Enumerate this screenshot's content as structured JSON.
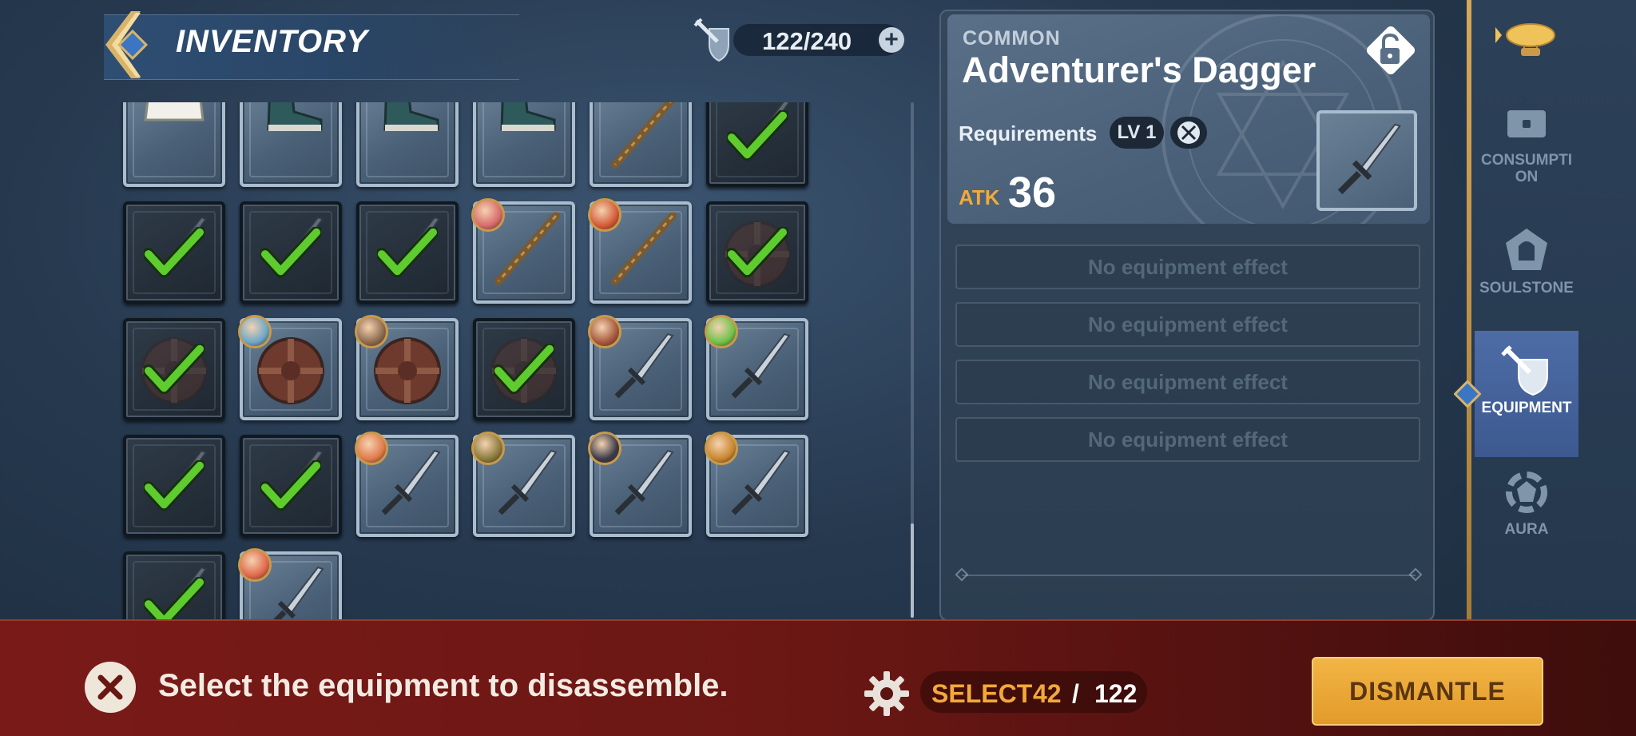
{
  "header": {
    "title": "INVENTORY",
    "capacity": "122/240",
    "capacity_icon": "sword-shield-icon",
    "add_icon": "plus-icon"
  },
  "grid": {
    "rows": [
      [
        {
          "item": "armor",
          "state": "normal"
        },
        {
          "item": "boots",
          "state": "normal"
        },
        {
          "item": "boots",
          "state": "normal"
        },
        {
          "item": "boots",
          "state": "normal"
        },
        {
          "item": "staff",
          "state": "normal"
        },
        {
          "item": "dagger",
          "state": "selected"
        }
      ],
      [
        {
          "item": "dagger",
          "state": "selected"
        },
        {
          "item": "dagger",
          "state": "selected"
        },
        {
          "item": "dagger",
          "state": "selected"
        },
        {
          "item": "staff",
          "state": "normal",
          "hero": "#d76b6b"
        },
        {
          "item": "staff",
          "state": "normal",
          "hero": "#d45a36"
        },
        {
          "item": "shield",
          "state": "selected"
        }
      ],
      [
        {
          "item": "shield",
          "state": "selected"
        },
        {
          "item": "shield",
          "state": "normal",
          "hero": "#6aa7c9"
        },
        {
          "item": "shield",
          "state": "normal",
          "hero": "#8c6a4f"
        },
        {
          "item": "shield",
          "state": "selected"
        },
        {
          "item": "dagger",
          "state": "normal",
          "hero": "#a5573c"
        },
        {
          "item": "dagger",
          "state": "normal",
          "hero": "#6fc24a"
        }
      ],
      [
        {
          "item": "dagger",
          "state": "selected"
        },
        {
          "item": "dagger",
          "state": "selected"
        },
        {
          "item": "dagger",
          "state": "normal",
          "hero": "#e07a4a"
        },
        {
          "item": "dagger",
          "state": "normal",
          "hero": "#8a7a3c"
        },
        {
          "item": "dagger",
          "state": "normal",
          "hero": "#3a3a4a"
        },
        {
          "item": "dagger",
          "state": "normal",
          "hero": "#c9872e"
        }
      ],
      [
        {
          "item": "dagger",
          "state": "selected"
        },
        {
          "item": "dagger",
          "state": "normal",
          "hero": "#e0684a"
        }
      ]
    ]
  },
  "detail": {
    "rarity": "COMMON",
    "name": "Adventurer's Dagger",
    "requirements_label": "Requirements",
    "level": "LV 1",
    "atk_label": "ATK",
    "atk_value": "36",
    "lock_icon": "unlocked-padlock-icon",
    "effects": [
      "No equipment effect",
      "No equipment effect",
      "No equipment effect",
      "No equipment effect"
    ]
  },
  "side_nav": {
    "items": [
      {
        "key": "consumption",
        "label_lines": [
          "CONSUMPTI",
          "ON"
        ],
        "icon": "chest-icon"
      },
      {
        "key": "soulstone",
        "label_lines": [
          "SOULSTONE"
        ],
        "icon": "soulstone-icon"
      },
      {
        "key": "equipment",
        "label_lines": [
          "EQUIPMENT"
        ],
        "icon": "sword-shield-icon",
        "active": true
      },
      {
        "key": "aura",
        "label_lines": [
          "AURA"
        ],
        "icon": "aura-icon"
      }
    ]
  },
  "bottom": {
    "instruction": "Select the equipment to disassemble.",
    "select_label": "SELECT",
    "select_count": "42",
    "select_separator": "/",
    "select_total": "122",
    "dismantle_label": "DISMANTLE"
  },
  "colors": {
    "accent_gold": "#f2a93a",
    "check_green": "#5ecb2e",
    "bottom_bar": "#6a1714",
    "active_tab": "#4d6ca6"
  }
}
